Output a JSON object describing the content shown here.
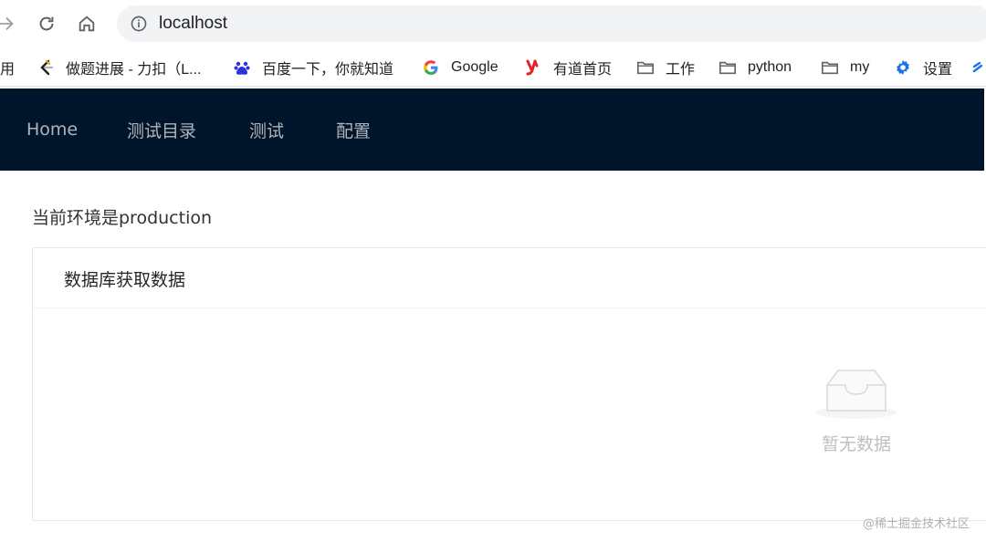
{
  "browser": {
    "url": "localhost",
    "icons": [
      "forward-arrow-icon",
      "reload-icon",
      "home-icon",
      "info-icon"
    ]
  },
  "bookmarks": [
    {
      "label": "用",
      "icon": "apps-icon"
    },
    {
      "label": "做题进展 - 力扣（L...",
      "icon": "leetcode-icon"
    },
    {
      "label": "百度一下，你就知道",
      "icon": "baidu-paw-icon"
    },
    {
      "label": "Google",
      "icon": "google-g-icon"
    },
    {
      "label": "有道首页",
      "icon": "youdao-icon"
    },
    {
      "label": "工作",
      "icon": "folder-icon"
    },
    {
      "label": "python",
      "icon": "folder-icon"
    },
    {
      "label": "my",
      "icon": "folder-icon"
    },
    {
      "label": "设置",
      "icon": "gear-icon"
    }
  ],
  "nav": {
    "items": [
      "Home",
      "测试目录",
      "测试",
      "配置"
    ],
    "background": "#001529"
  },
  "content": {
    "env_text": "当前环境是production",
    "card_title": "数据库获取数据",
    "empty_text": "暂无数据"
  },
  "watermark": "@稀土掘金技术社区"
}
